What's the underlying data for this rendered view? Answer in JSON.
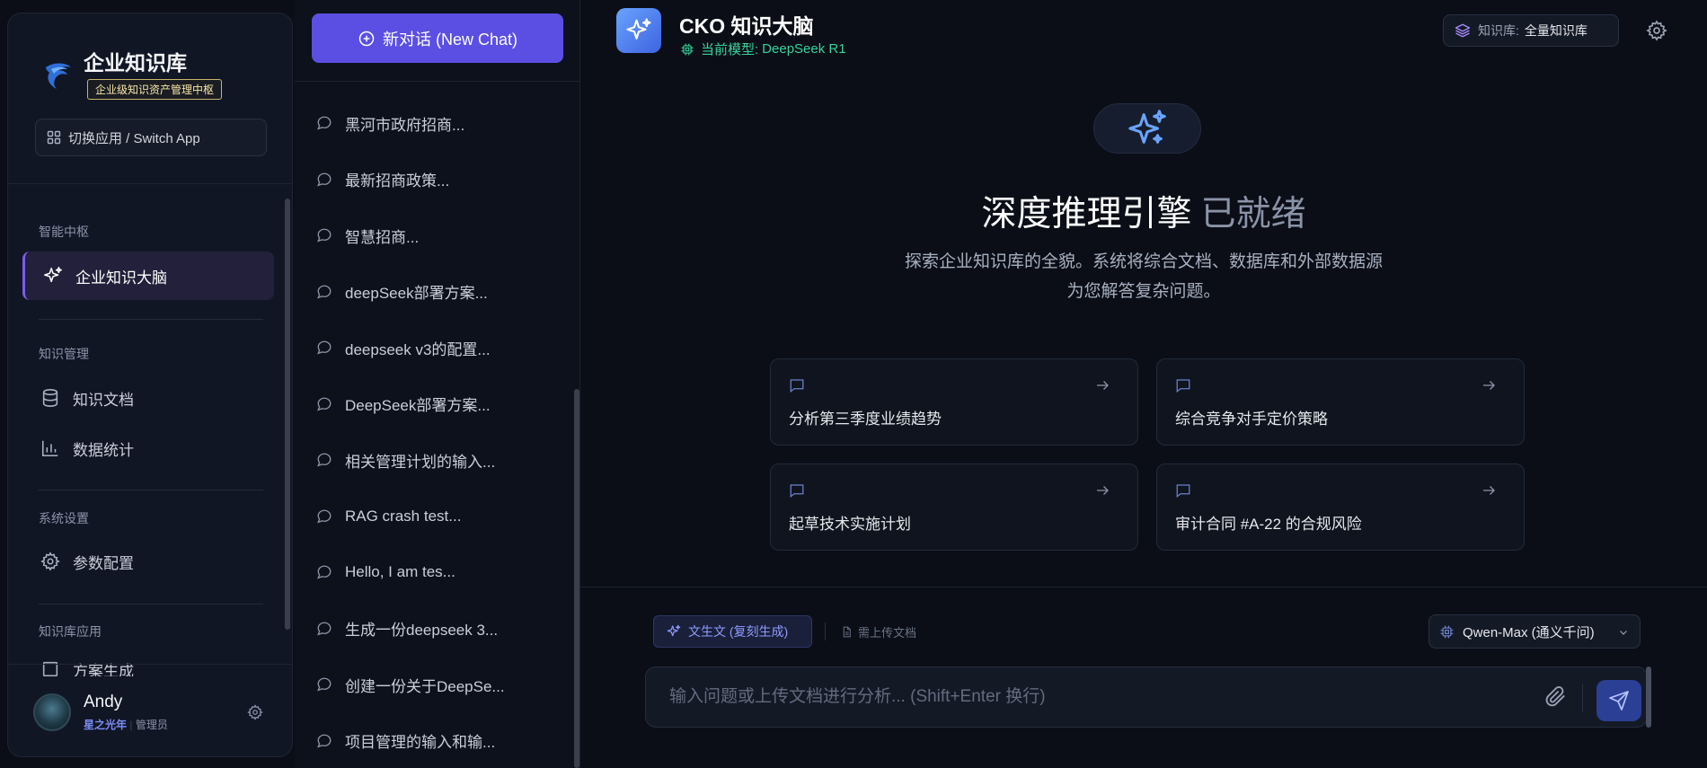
{
  "sidebar": {
    "brand_name": "企业知识库",
    "brand_badge": "企业级知识资产管理中枢",
    "switch_label": "切换应用 / Switch App",
    "sections": {
      "intel": "智能中枢",
      "knowledge": "知识管理",
      "system": "系统设置",
      "apps": "知识库应用"
    },
    "items": {
      "brain": "企业知识大脑",
      "docs": "知识文档",
      "stats": "数据统计",
      "config": "参数配置",
      "plan": "方案生成"
    }
  },
  "user": {
    "name": "Andy",
    "org": "星之光年",
    "role": "管理员"
  },
  "history": {
    "new_chat": "新对话 (New Chat)",
    "items": [
      "黑河市政府招商...",
      "最新招商政策...",
      "智慧招商...",
      "deepSeek部署方案...",
      "deepseek v3的配置...",
      "DeepSeek部署方案...",
      "相关管理计划的输入...",
      "RAG crash test...",
      "Hello, I am tes...",
      "生成一份deepseek 3...",
      "创建一份关于DeepSe...",
      "项目管理的输入和输..."
    ]
  },
  "header": {
    "title": "CKO 知识大脑",
    "model_prefix": "当前模型:",
    "model_name": "DeepSeek R1",
    "kb_label": "知识库:",
    "kb_value": "全量知识库"
  },
  "hero": {
    "title": "深度推理引擎",
    "title_status": "已就绪",
    "desc_line1": "探索企业知识库的全貌。系统将综合文档、数据库和外部数据源",
    "desc_line2": "为您解答复杂问题。"
  },
  "suggestions": [
    "分析第三季度业绩趋势",
    "综合竞争对手定价策略",
    "起草技术实施计划",
    "审计合同 #A-22 的合规风险"
  ],
  "composer": {
    "mode_label": "文生文 (复刻生成)",
    "upload_hint": "需上传文档",
    "model_select": "Qwen-Max (通义千问)",
    "placeholder": "输入问题或上传文档进行分析... (Shift+Enter 换行)"
  },
  "colors": {
    "accent": "#5b4fe3",
    "active_nav": "#7c5cf0",
    "model_status": "#34d399",
    "send": "#2b3f95"
  }
}
